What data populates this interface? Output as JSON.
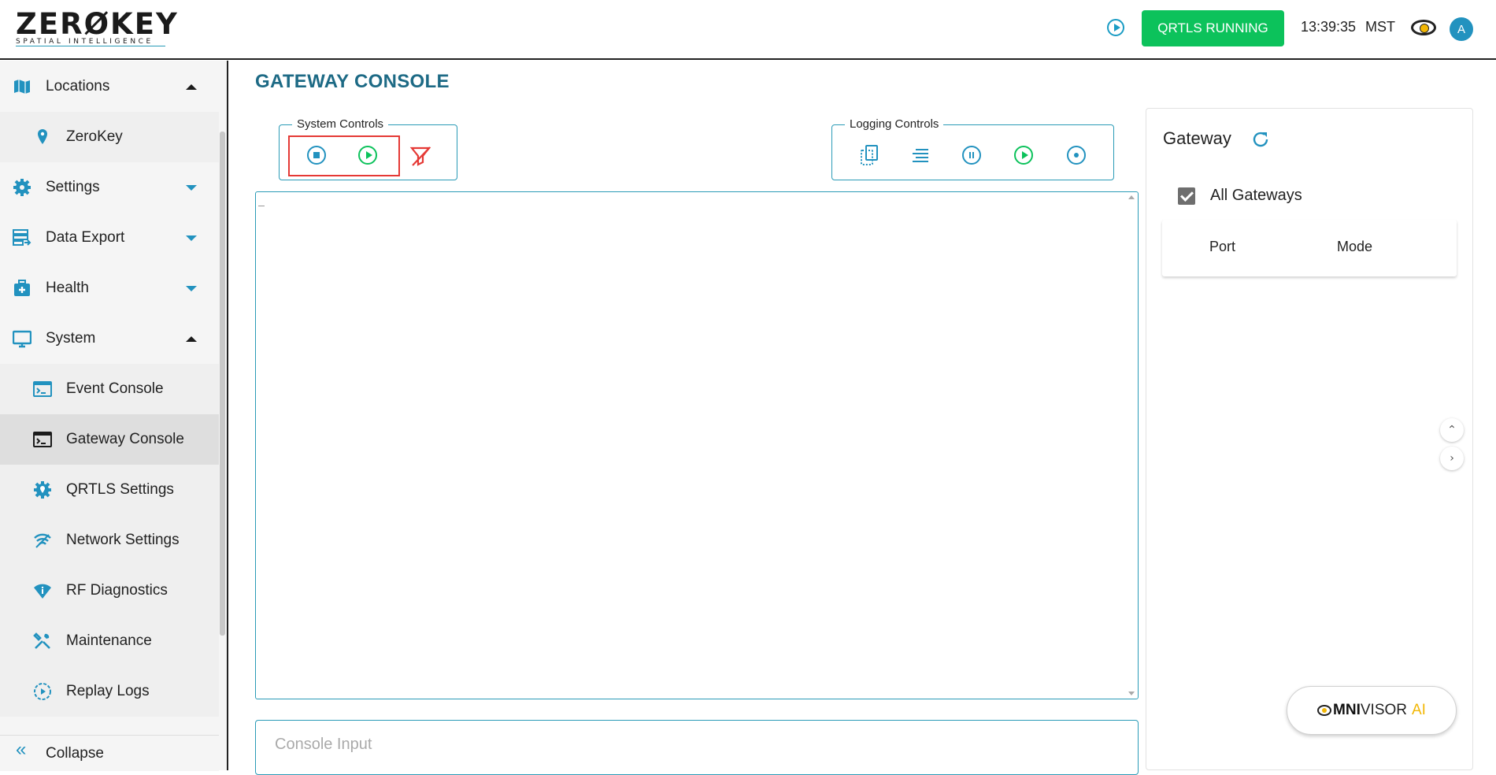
{
  "header": {
    "logo_text": "ZERØKEY",
    "logo_tagline": "SPATIAL INTELLIGENCE",
    "status_button": "QRTLS RUNNING",
    "time": "13:39:35",
    "timezone": "MST",
    "avatar_initial": "A",
    "colors": {
      "status_green": "#0cc25b",
      "accent_blue": "#2292bf"
    }
  },
  "sidebar": {
    "items": [
      {
        "label": "Locations",
        "icon": "map-icon",
        "expanded": true
      },
      {
        "label": "ZeroKey",
        "icon": "location-pin-icon",
        "sub": true
      },
      {
        "label": "Settings",
        "icon": "gear-icon",
        "expanded": false
      },
      {
        "label": "Data Export",
        "icon": "data-export-icon",
        "expanded": false
      },
      {
        "label": "Health",
        "icon": "medical-kit-icon",
        "expanded": false
      },
      {
        "label": "System",
        "icon": "monitor-icon",
        "expanded": true
      },
      {
        "label": "Event Console",
        "icon": "console-icon",
        "sub": true
      },
      {
        "label": "Gateway Console",
        "icon": "terminal-icon",
        "sub": true,
        "active": true
      },
      {
        "label": "QRTLS Settings",
        "icon": "qrtls-settings-icon",
        "sub": true
      },
      {
        "label": "Network Settings",
        "icon": "network-icon",
        "sub": true
      },
      {
        "label": "RF Diagnostics",
        "icon": "rf-diagnostics-icon",
        "sub": true
      },
      {
        "label": "Maintenance",
        "icon": "tools-icon",
        "sub": true
      },
      {
        "label": "Replay Logs",
        "icon": "replay-icon",
        "sub": true
      }
    ],
    "collapse_label": "Collapse"
  },
  "main": {
    "title": "GATEWAY CONSOLE",
    "system_controls_label": "System Controls",
    "logging_controls_label": "Logging Controls",
    "console_input_placeholder": "Console Input"
  },
  "gateway_panel": {
    "title": "Gateway",
    "all_gateways_label": "All Gateways",
    "all_gateways_checked": true,
    "columns": [
      "Port",
      "Mode"
    ]
  },
  "omnivisor": {
    "label_bold": "MNI",
    "label_rest": "VISOR",
    "label_ai": "AI"
  }
}
